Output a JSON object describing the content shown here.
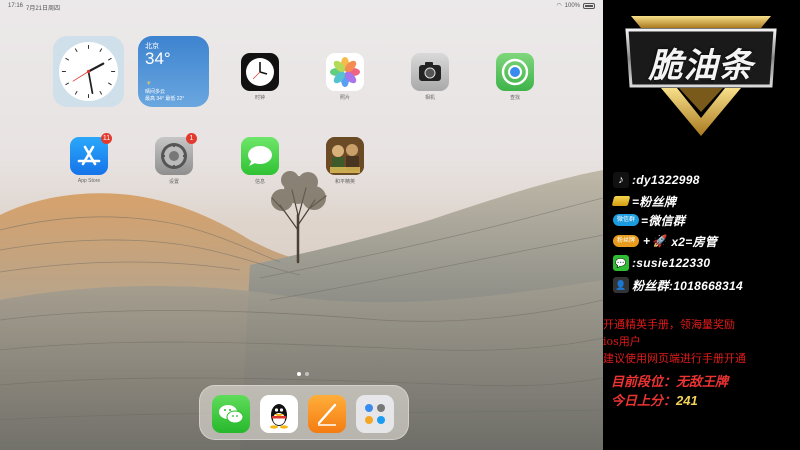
{
  "status_bar": {
    "time": "17:16",
    "date": "7月21日周四",
    "battery": "100%"
  },
  "widgets": {
    "weather": {
      "city": "北京",
      "temp": "34°",
      "condition": "晴间多云",
      "range": "最高 34° 最低 22°"
    }
  },
  "apps_row1": [
    {
      "name": "clock-app",
      "label": "时钟",
      "icon": "clock-icon"
    },
    {
      "name": "photos-app",
      "label": "照片",
      "icon": "photos-icon"
    },
    {
      "name": "camera-app",
      "label": "相机",
      "icon": "camera-icon"
    },
    {
      "name": "findmy-app",
      "label": "查找",
      "icon": "findmy-icon"
    }
  ],
  "apps_row2": [
    {
      "name": "appstore-app",
      "label": "App Store",
      "icon": "appstore-icon",
      "badge": "11"
    },
    {
      "name": "settings-app",
      "label": "设置",
      "icon": "settings-icon",
      "badge": "1"
    },
    {
      "name": "messages-app",
      "label": "信息",
      "icon": "messages-icon"
    },
    {
      "name": "game-app",
      "label": "和平精英",
      "icon": "game-icon"
    }
  ],
  "dock": [
    {
      "name": "wechat-app",
      "icon": "wechat-icon"
    },
    {
      "name": "qq-app",
      "icon": "qq-icon"
    },
    {
      "name": "pages-app",
      "icon": "pages-icon"
    },
    {
      "name": "folder-app",
      "icon": "folder-icon"
    }
  ],
  "overlay": {
    "logo": "脆油条",
    "douyin": ":dy1322998",
    "fan_badge": "=粉丝牌",
    "wechat_pill": "微信群",
    "wechat_group": "=微信群",
    "pill_fans": "粉丝牌",
    "gift_text": "x2=房管",
    "wechat_id": ":susie122330",
    "fan_group": "粉丝群:1018668314",
    "notice": [
      "开通精英手册，领海量奖励",
      "ios用户",
      "建议使用网页端进行手册开通"
    ],
    "rank_label": "目前段位：",
    "rank_value": "无敌王牌",
    "today_label": "今日上分：",
    "today_value": "241"
  },
  "colors": {
    "accent_red": "#e11a1a",
    "gold": "#f1d15a",
    "weather_blue": "#3d83cf"
  }
}
